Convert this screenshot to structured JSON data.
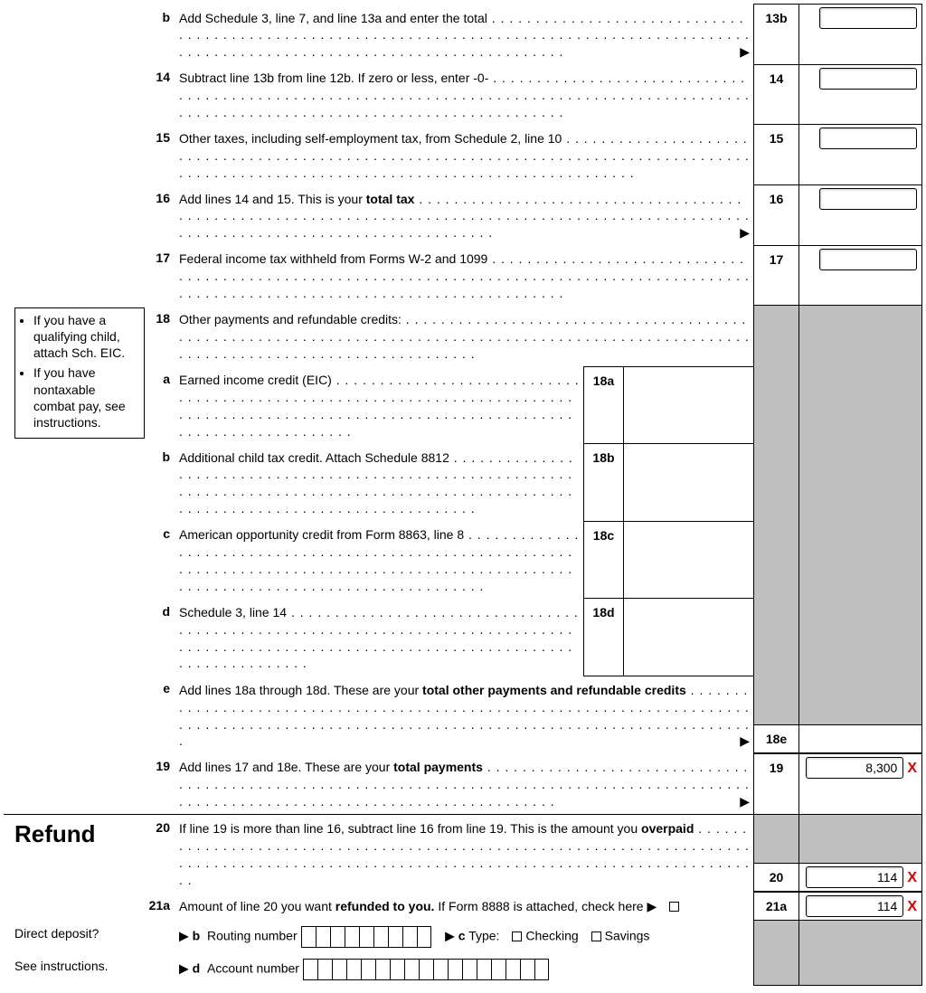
{
  "lines": {
    "l13b": {
      "letter": "b",
      "num": "13b",
      "text": "Add Schedule 3, line 7, and line 13a and enter the total"
    },
    "l14": {
      "num": "14",
      "text": "Subtract line 13b from line 12b. If zero or less, enter -0-"
    },
    "l15": {
      "num": "15",
      "text": "Other taxes, including self-employment tax, from Schedule 2, line 10"
    },
    "l16": {
      "num": "16",
      "text_a": "Add lines 14 and 15. This is your ",
      "bold": "total tax"
    },
    "l17": {
      "num": "17",
      "text": "Federal income tax withheld from Forms W-2 and 1099"
    },
    "l18": {
      "num": "18",
      "text": "Other payments and refundable credits:"
    },
    "l18a": {
      "letter": "a",
      "num": "18a",
      "text": "Earned income credit (EIC)"
    },
    "l18b": {
      "letter": "b",
      "num": "18b",
      "text": "Additional child tax credit. Attach Schedule 8812"
    },
    "l18c": {
      "letter": "c",
      "num": "18c",
      "text": "American opportunity credit from Form 8863, line 8"
    },
    "l18d": {
      "letter": "d",
      "num": "18d",
      "text": "Schedule 3, line 14"
    },
    "l18e": {
      "letter": "e",
      "num": "18e",
      "text_a": "Add lines 18a through 18d. These are your ",
      "bold": "total other payments and refundable credits"
    },
    "l19": {
      "num": "19",
      "text_a": "Add lines 17 and 18e. These are your ",
      "bold": "total payments",
      "value": "8,300"
    },
    "l20": {
      "num": "20",
      "text_a": "If line 19 is more than line 16, subtract line 16 from line 19. This is the amount you ",
      "bold": "overpaid",
      "value": "114"
    },
    "l21a": {
      "num": "21a",
      "text_a": "Amount of line 20 you want ",
      "bold": "refunded to you.",
      "text_b": " If Form 8888 is attached, check here",
      "value": "114"
    },
    "l21b": {
      "letter": "b",
      "label": "Routing number"
    },
    "l21c": {
      "letter": "c",
      "label": "Type:",
      "opt1": "Checking",
      "opt2": "Savings"
    },
    "l21d": {
      "letter": "d",
      "label": "Account number"
    }
  },
  "side": {
    "b1": "If you have a qualifying child, attach Sch. EIC.",
    "b2": "If you have nontaxable combat pay, see instructions."
  },
  "section": {
    "refund": "Refund",
    "dd": "Direct deposit?",
    "see": "See instructions."
  },
  "glyph": {
    "arrow": "▶"
  }
}
